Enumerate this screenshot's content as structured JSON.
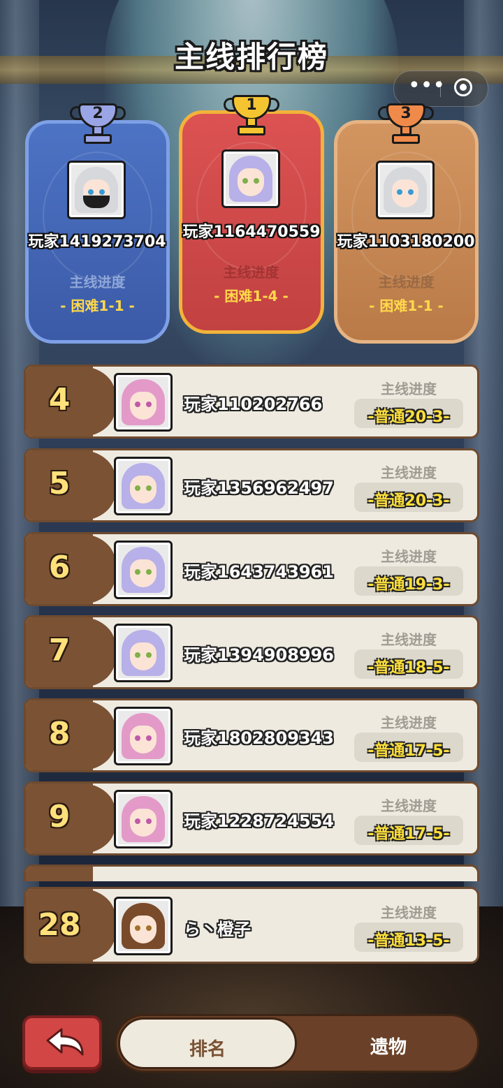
{
  "title": "主线排行榜",
  "capsule": {
    "more_icon": "more-dots-icon",
    "close_icon": "target-close-icon"
  },
  "podium": [
    {
      "rank": "2",
      "name": "玩家1419273704",
      "progress_label": "主线进度",
      "progress": "- 困难1-1 -",
      "color": "#4d73c4"
    },
    {
      "rank": "1",
      "name": "玩家1164470559",
      "progress_label": "主线进度",
      "progress": "- 困难1-4 -",
      "color": "#dc5252"
    },
    {
      "rank": "3",
      "name": "玩家1103180200",
      "progress_label": "主线进度",
      "progress": "- 困难1-1 -",
      "color": "#d39560"
    }
  ],
  "rows": [
    {
      "rank": "4",
      "name": "玩家110202766",
      "progress_label": "主线进度",
      "progress": "-普通20-3-"
    },
    {
      "rank": "5",
      "name": "玩家1356962497",
      "progress_label": "主线进度",
      "progress": "-普通20-3-"
    },
    {
      "rank": "6",
      "name": "玩家1643743961",
      "progress_label": "主线进度",
      "progress": "-普通19-3-"
    },
    {
      "rank": "7",
      "name": "玩家1394908996",
      "progress_label": "主线进度",
      "progress": "-普通18-5-"
    },
    {
      "rank": "8",
      "name": "玩家1802809343",
      "progress_label": "主线进度",
      "progress": "-普通17-5-"
    },
    {
      "rank": "9",
      "name": "玩家1228724554",
      "progress_label": "主线进度",
      "progress": "-普通17-5-"
    }
  ],
  "self_row": {
    "rank": "28",
    "name": "ら丶橙子",
    "progress_label": "主线进度",
    "progress": "-普通13-5-"
  },
  "bottom": {
    "back_icon": "back-arrow-icon",
    "tab_rank": "排名",
    "tab_relics": "遗物"
  }
}
